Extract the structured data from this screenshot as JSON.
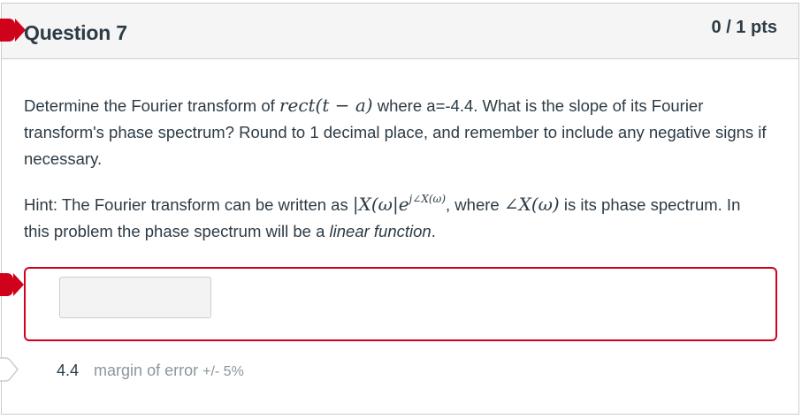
{
  "header": {
    "title": "Question 7",
    "points": "0 / 1 pts"
  },
  "question": {
    "p1_before": "Determine the Fourier transform of ",
    "p1_math": "rect(t − a)",
    "p1_after": " where a=-4.4. What is the slope of its Fourier transform's phase spectrum? Round to 1 decimal place, and remember to include any negative signs if necessary.",
    "p2_before": "Hint: The Fourier transform can be written as ",
    "p2_math_base": "|X(ω|e",
    "p2_math_sup": "j∠X(ω)",
    "p2_middle": ", where ",
    "p2_math2": "∠X(ω)",
    "p2_after": " is its phase spectrum. In this problem the phase spectrum will be a ",
    "p2_emphasis": "linear function",
    "p2_end": "."
  },
  "answer": {
    "value": "",
    "correct_value": "4.4",
    "margin_label": "margin of error",
    "margin_value": "+/- 5%"
  },
  "colors": {
    "incorrect": "#d0021b",
    "text": "#2d3b45",
    "muted": "#8b969e"
  }
}
